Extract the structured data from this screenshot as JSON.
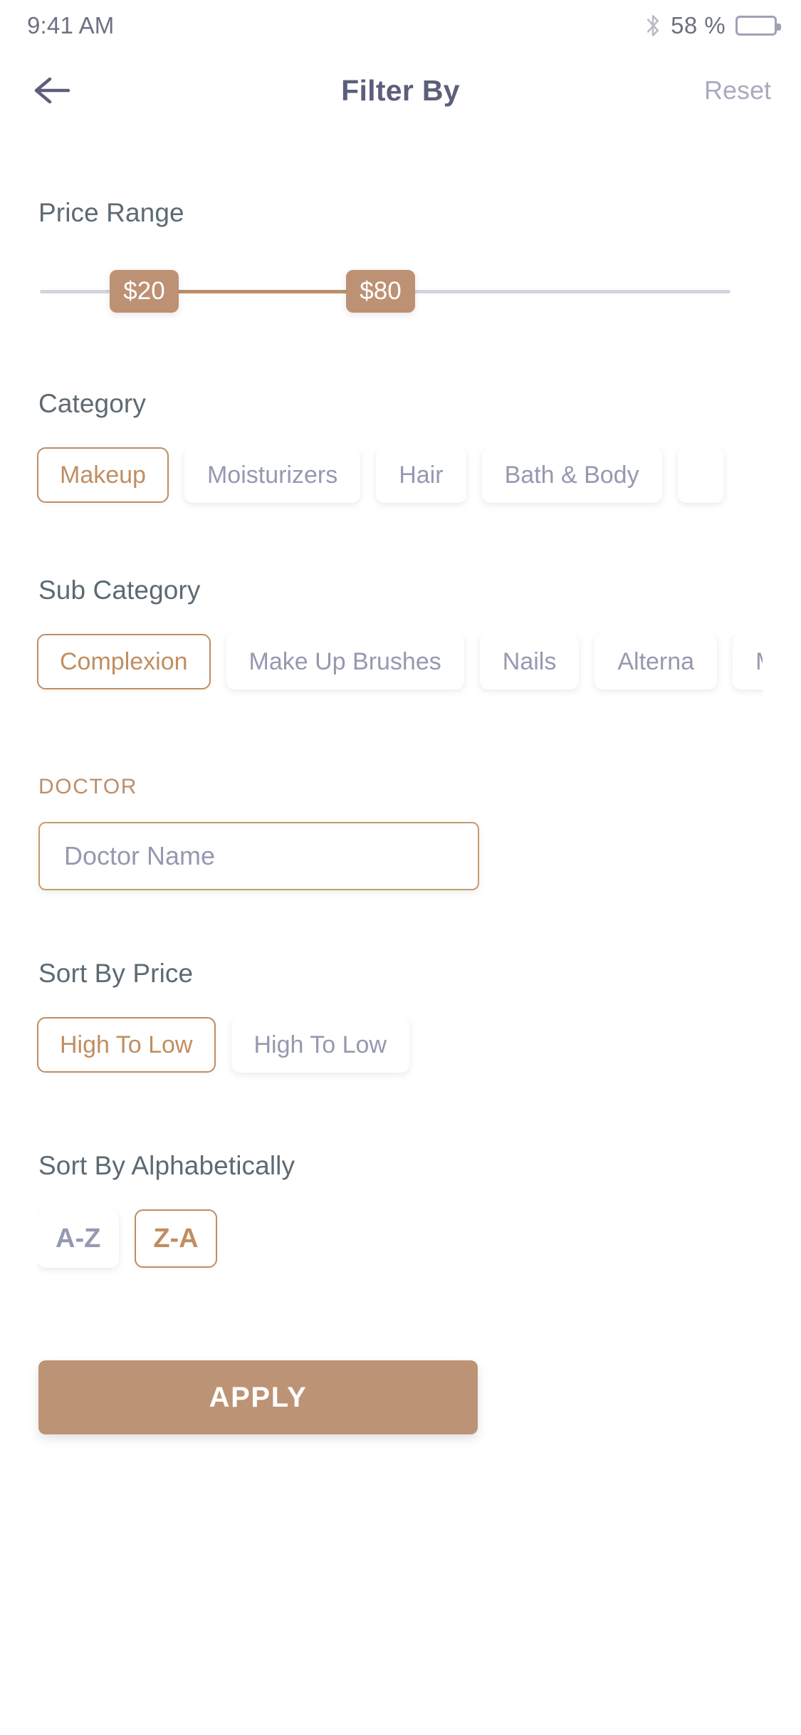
{
  "status_bar": {
    "time": "9:41 AM",
    "bluetooth_icon": "bluetooth-icon",
    "battery_percent": "58 %",
    "battery_icon": "battery-icon"
  },
  "header": {
    "back_icon": "arrow-left-icon",
    "title": "Filter By",
    "reset_label": "Reset"
  },
  "price_range": {
    "label": "Price Range",
    "min_value": "$20",
    "max_value": "$80",
    "track_color": "#d2d5de",
    "range_color": "#bd8f69",
    "thumb_color": "#bd9173"
  },
  "category": {
    "label": "Category",
    "chips": [
      {
        "label": "Makeup",
        "selected": true
      },
      {
        "label": "Moisturizers",
        "selected": false
      },
      {
        "label": "Hair",
        "selected": false
      },
      {
        "label": "Bath & Body",
        "selected": false
      },
      {
        "label": "",
        "selected": false
      }
    ]
  },
  "sub_category": {
    "label": "Sub Category",
    "chips": [
      {
        "label": "Complexion",
        "selected": true
      },
      {
        "label": "Make Up Brushes",
        "selected": false
      },
      {
        "label": "Nails",
        "selected": false
      },
      {
        "label": "Alterna",
        "selected": false
      },
      {
        "label": "M",
        "selected": false
      }
    ]
  },
  "doctor": {
    "label": "DOCTOR",
    "placeholder": "Doctor Name",
    "value": ""
  },
  "sort_by_price": {
    "label": "Sort By Price",
    "chips": [
      {
        "label": "High To Low",
        "selected": true
      },
      {
        "label": "High To Low",
        "selected": false
      }
    ]
  },
  "sort_by_alphabetically": {
    "label": "Sort By Alphabetically",
    "chips": [
      {
        "label": "A-Z",
        "selected": false
      },
      {
        "label": "Z-A",
        "selected": true
      }
    ]
  },
  "apply": {
    "label": "APPLY",
    "color": "#bd9375"
  },
  "theme": {
    "accent": "#bd9375",
    "accent_border": "#c08e61",
    "text_dark": "#5c5f7a",
    "text_muted": "#9599b0",
    "label": "#5d6a72"
  }
}
